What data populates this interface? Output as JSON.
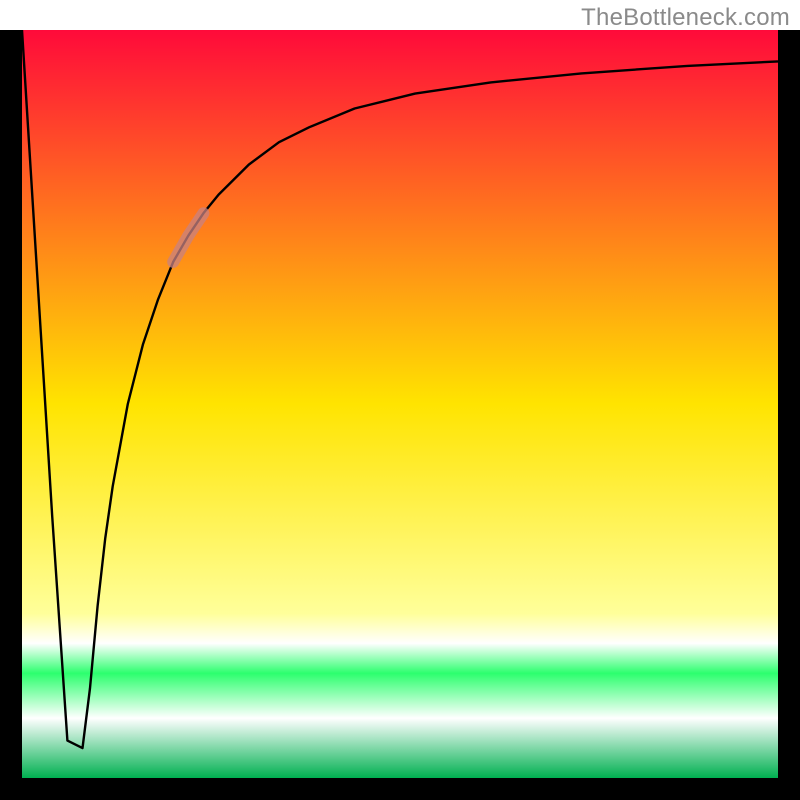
{
  "attribution": "TheBottleneck.com",
  "colors": {
    "frame": "#000000",
    "curve": "#000000",
    "marker": "#c88282",
    "grad_top": "#ff0a3a",
    "grad_mid": "#ffe400",
    "grad_green_bright": "#2cff6e",
    "grad_white": "#ffffff",
    "grad_green_deep": "#00b050"
  },
  "chart_data": {
    "type": "line",
    "title": "",
    "xlabel": "",
    "ylabel": "",
    "xlim": [
      0,
      100
    ],
    "ylim": [
      0,
      100
    ],
    "legend": false,
    "grid": false,
    "x": [
      0,
      4,
      6,
      8,
      9,
      10,
      11,
      12,
      14,
      16,
      18,
      20,
      22,
      24,
      26,
      28,
      30,
      34,
      38,
      44,
      52,
      62,
      74,
      88,
      100
    ],
    "y": [
      100,
      35,
      5,
      4,
      12,
      23,
      32,
      39,
      50,
      58,
      64,
      69,
      72.5,
      75.5,
      78,
      80,
      82,
      85,
      87,
      89.5,
      91.5,
      93,
      94.2,
      95.2,
      95.8
    ],
    "marker": {
      "x_range": [
        20,
        24
      ],
      "y_range": [
        69,
        75.5
      ],
      "note": "Highlighted segment on the rising curve"
    },
    "background_gradient": [
      {
        "pos": 0.0,
        "color": "#ff0a3a"
      },
      {
        "pos": 0.5,
        "color": "#ffe400"
      },
      {
        "pos": 0.78,
        "color": "#ffff9a"
      },
      {
        "pos": 0.82,
        "color": "#ffffff"
      },
      {
        "pos": 0.86,
        "color": "#2cff6e"
      },
      {
        "pos": 0.92,
        "color": "#ffffff"
      },
      {
        "pos": 1.0,
        "color": "#00b050"
      }
    ]
  }
}
